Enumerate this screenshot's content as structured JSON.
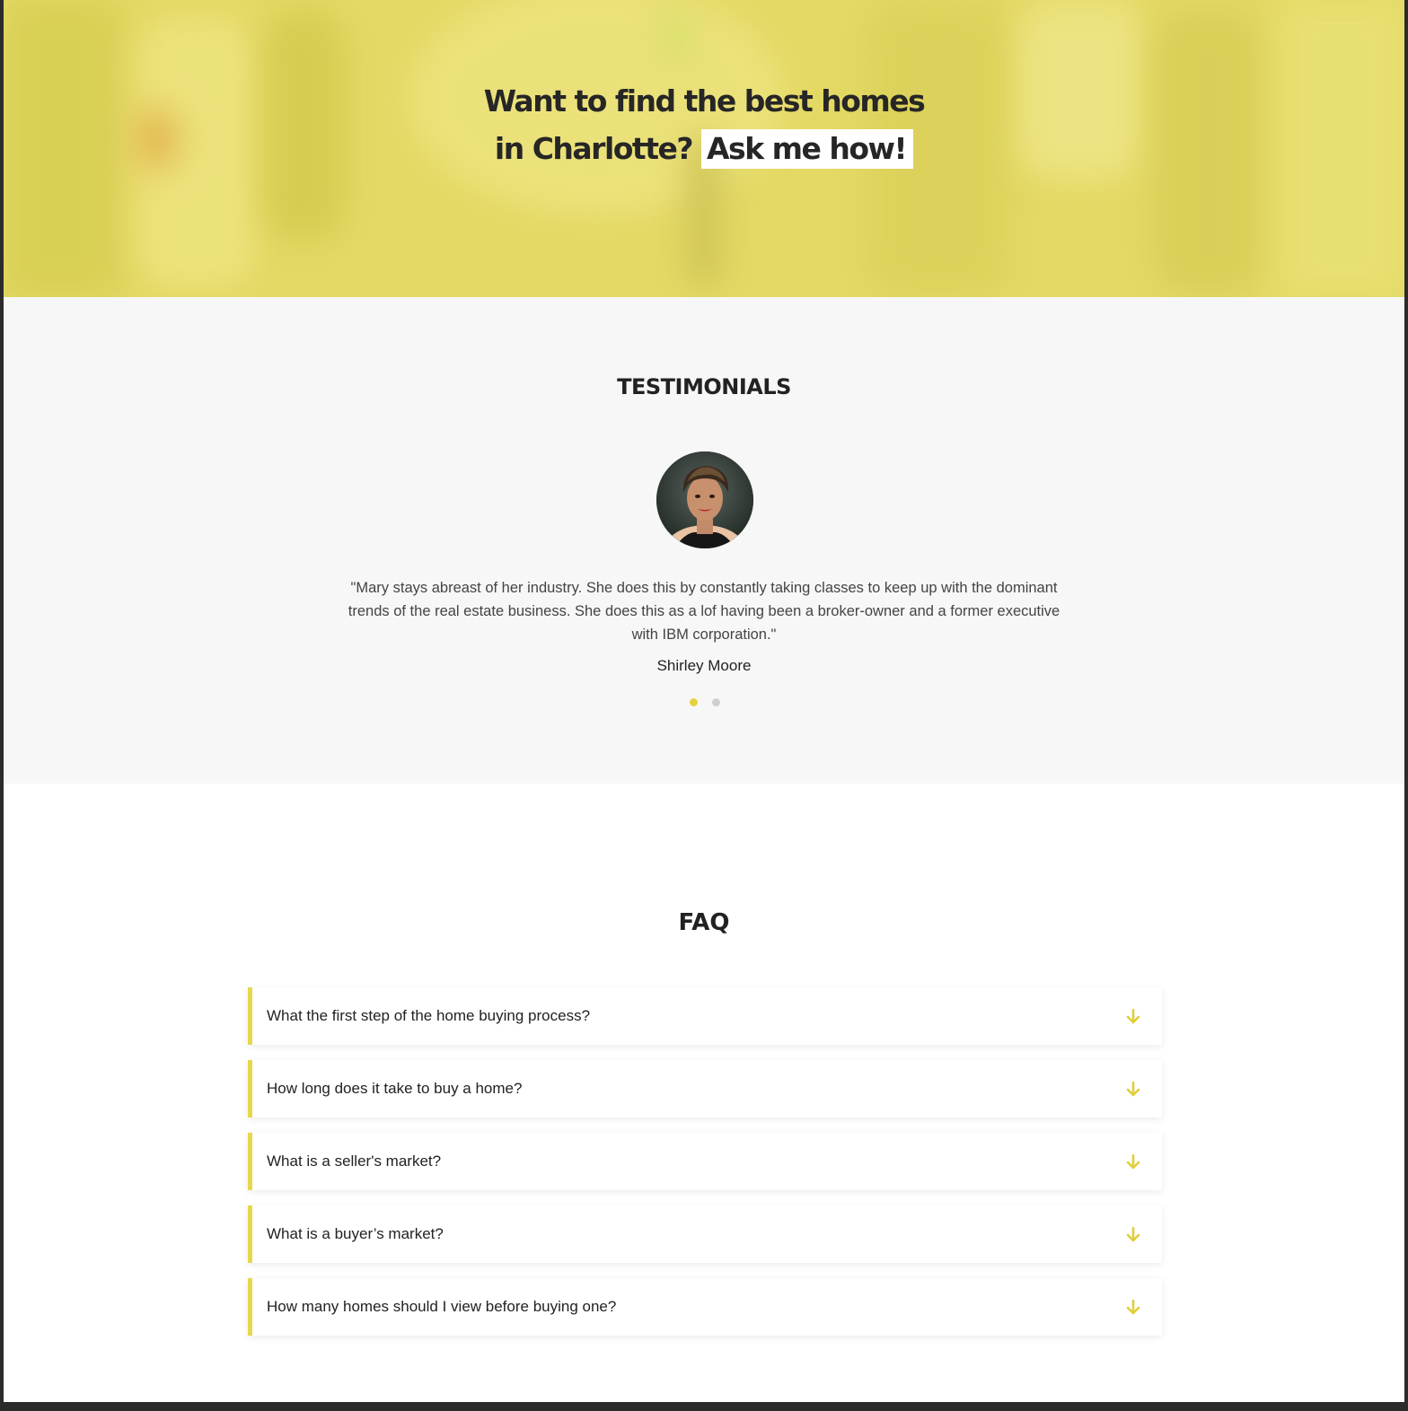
{
  "hero": {
    "title_line1": "Want to find the best homes",
    "title_line2": "in Charlotte?",
    "title_highlight": "Ask me how!",
    "overlay_color": "#e4d964"
  },
  "testimonials": {
    "heading": "TESTIMONIALS",
    "items": [
      {
        "quote": "\"Mary stays abreast of her industry. She does this by constantly taking classes to keep up with the dominant trends of the real estate business. She does this as a lof having been a broker-owner and a former executive with IBM corporation.\"",
        "author": "Shirley Moore"
      }
    ],
    "active_slide": 1,
    "total_slides": 2
  },
  "faq": {
    "heading": "FAQ",
    "items": [
      {
        "question": "What the first step of the home buying process?",
        "icon": "arrow-down-icon"
      },
      {
        "question": "How long does it take to buy a home?",
        "icon": "arrow-down-icon"
      },
      {
        "question": "What is a seller's market?",
        "icon": "arrow-down-icon"
      },
      {
        "question": "What is a buyer’s market?",
        "icon": "arrow-down-icon"
      },
      {
        "question": "How many homes should I view before buying one?",
        "icon": "arrow-down-icon"
      }
    ]
  },
  "colors": {
    "accent": "#e6d84a",
    "dot_inactive": "#cfcfcf",
    "section_bg": "#f7f7f7",
    "text": "#222222"
  }
}
